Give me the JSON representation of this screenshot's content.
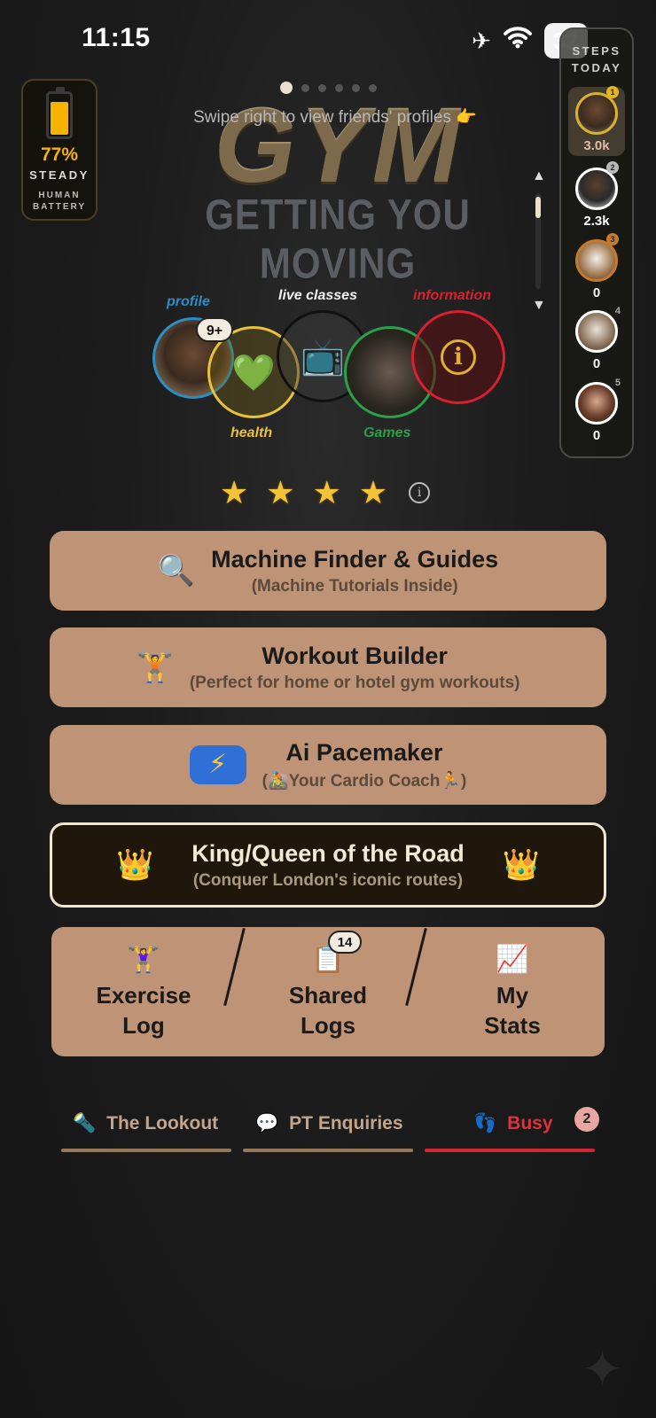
{
  "status": {
    "time": "11:15",
    "battery": "32",
    "airplane_icon": "airplane-icon",
    "wifi_icon": "wifi-icon"
  },
  "human_battery": {
    "percent": "77%",
    "level": 0.77,
    "state": "STEADY",
    "label_line1": "HUMAN",
    "label_line2": "BATTERY"
  },
  "pager": {
    "count": 6,
    "active": 0,
    "hint": "Swipe right to view friends' profiles 👉"
  },
  "logo": {
    "word": "GYM",
    "tagline": "GETTING YOU MOVING"
  },
  "steps": {
    "title_line1": "STEPS",
    "title_line2": "TODAY",
    "leaders": [
      {
        "rank": "1",
        "steps": "3.0k"
      },
      {
        "rank": "2",
        "steps": "2.3k"
      },
      {
        "rank": "3",
        "steps": "0"
      },
      {
        "rank": "4",
        "steps": "0"
      },
      {
        "rank": "5",
        "steps": "0"
      }
    ]
  },
  "rings": {
    "profile": {
      "label": "profile",
      "badge": "9+",
      "color": "#2a8fc7"
    },
    "health": {
      "label": "health",
      "icon": "💚",
      "color": "#e8c23a"
    },
    "live": {
      "label": "live classes",
      "icon": "📺",
      "color": "#111111"
    },
    "games": {
      "label": "Games",
      "color": "#2aa048"
    },
    "information": {
      "label": "information",
      "icon": "i",
      "color": "#d8202e"
    }
  },
  "rating": {
    "stars": [
      "★",
      "★",
      "★",
      "★"
    ],
    "info_icon": "i"
  },
  "menu": {
    "machine_finder": {
      "icon": "🔍",
      "title": "Machine Finder & Guides",
      "subtitle": "(Machine Tutorials Inside)"
    },
    "workout_builder": {
      "icon": "🏋️",
      "title": "Workout Builder",
      "subtitle": "(Perfect for home or hotel gym workouts)"
    },
    "pacemaker": {
      "icon": "⚡",
      "title": "Ai Pacemaker",
      "subtitle": "(🚵Your Cardio Coach🏃)"
    },
    "king": {
      "crown": "👑",
      "title": "King/Queen of the Road",
      "subtitle": "(Conquer London's iconic routes)"
    }
  },
  "tiles": {
    "exercise_log": {
      "icon": "🏋️‍♀️",
      "line1": "Exercise",
      "line2": "Log"
    },
    "shared_logs": {
      "icon": "📋",
      "line1": "Shared",
      "line2": "Logs",
      "badge": "14"
    },
    "my_stats": {
      "icon": "📈",
      "line1": "My",
      "line2": "Stats"
    }
  },
  "tabs": [
    {
      "icon": "🔦",
      "label": "The Lookout",
      "color": "#c4a48a",
      "line": "#9a7658"
    },
    {
      "icon": "💬",
      "label": "PT Enquiries",
      "color": "#c4a48a",
      "line": "#9a7658"
    },
    {
      "icon": "👣",
      "label": "Busy",
      "color": "#e0303c",
      "line": "#d42830",
      "badge": "2"
    }
  ],
  "colors": {
    "tile": "#bf9476",
    "king_bg": "#1f170b",
    "accent": "#f5b400"
  }
}
